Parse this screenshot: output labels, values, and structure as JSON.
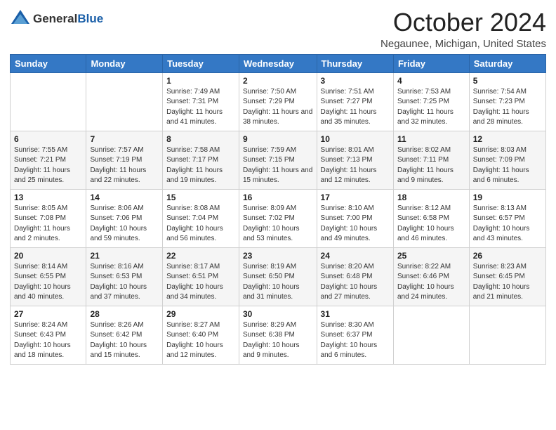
{
  "header": {
    "logo": {
      "general": "General",
      "blue": "Blue"
    },
    "month": "October 2024",
    "location": "Negaunee, Michigan, United States"
  },
  "weekdays": [
    "Sunday",
    "Monday",
    "Tuesday",
    "Wednesday",
    "Thursday",
    "Friday",
    "Saturday"
  ],
  "weeks": [
    [
      {
        "day": "",
        "info": ""
      },
      {
        "day": "",
        "info": ""
      },
      {
        "day": "1",
        "info": "Sunrise: 7:49 AM\nSunset: 7:31 PM\nDaylight: 11 hours and 41 minutes."
      },
      {
        "day": "2",
        "info": "Sunrise: 7:50 AM\nSunset: 7:29 PM\nDaylight: 11 hours and 38 minutes."
      },
      {
        "day": "3",
        "info": "Sunrise: 7:51 AM\nSunset: 7:27 PM\nDaylight: 11 hours and 35 minutes."
      },
      {
        "day": "4",
        "info": "Sunrise: 7:53 AM\nSunset: 7:25 PM\nDaylight: 11 hours and 32 minutes."
      },
      {
        "day": "5",
        "info": "Sunrise: 7:54 AM\nSunset: 7:23 PM\nDaylight: 11 hours and 28 minutes."
      }
    ],
    [
      {
        "day": "6",
        "info": "Sunrise: 7:55 AM\nSunset: 7:21 PM\nDaylight: 11 hours and 25 minutes."
      },
      {
        "day": "7",
        "info": "Sunrise: 7:57 AM\nSunset: 7:19 PM\nDaylight: 11 hours and 22 minutes."
      },
      {
        "day": "8",
        "info": "Sunrise: 7:58 AM\nSunset: 7:17 PM\nDaylight: 11 hours and 19 minutes."
      },
      {
        "day": "9",
        "info": "Sunrise: 7:59 AM\nSunset: 7:15 PM\nDaylight: 11 hours and 15 minutes."
      },
      {
        "day": "10",
        "info": "Sunrise: 8:01 AM\nSunset: 7:13 PM\nDaylight: 11 hours and 12 minutes."
      },
      {
        "day": "11",
        "info": "Sunrise: 8:02 AM\nSunset: 7:11 PM\nDaylight: 11 hours and 9 minutes."
      },
      {
        "day": "12",
        "info": "Sunrise: 8:03 AM\nSunset: 7:09 PM\nDaylight: 11 hours and 6 minutes."
      }
    ],
    [
      {
        "day": "13",
        "info": "Sunrise: 8:05 AM\nSunset: 7:08 PM\nDaylight: 11 hours and 2 minutes."
      },
      {
        "day": "14",
        "info": "Sunrise: 8:06 AM\nSunset: 7:06 PM\nDaylight: 10 hours and 59 minutes."
      },
      {
        "day": "15",
        "info": "Sunrise: 8:08 AM\nSunset: 7:04 PM\nDaylight: 10 hours and 56 minutes."
      },
      {
        "day": "16",
        "info": "Sunrise: 8:09 AM\nSunset: 7:02 PM\nDaylight: 10 hours and 53 minutes."
      },
      {
        "day": "17",
        "info": "Sunrise: 8:10 AM\nSunset: 7:00 PM\nDaylight: 10 hours and 49 minutes."
      },
      {
        "day": "18",
        "info": "Sunrise: 8:12 AM\nSunset: 6:58 PM\nDaylight: 10 hours and 46 minutes."
      },
      {
        "day": "19",
        "info": "Sunrise: 8:13 AM\nSunset: 6:57 PM\nDaylight: 10 hours and 43 minutes."
      }
    ],
    [
      {
        "day": "20",
        "info": "Sunrise: 8:14 AM\nSunset: 6:55 PM\nDaylight: 10 hours and 40 minutes."
      },
      {
        "day": "21",
        "info": "Sunrise: 8:16 AM\nSunset: 6:53 PM\nDaylight: 10 hours and 37 minutes."
      },
      {
        "day": "22",
        "info": "Sunrise: 8:17 AM\nSunset: 6:51 PM\nDaylight: 10 hours and 34 minutes."
      },
      {
        "day": "23",
        "info": "Sunrise: 8:19 AM\nSunset: 6:50 PM\nDaylight: 10 hours and 31 minutes."
      },
      {
        "day": "24",
        "info": "Sunrise: 8:20 AM\nSunset: 6:48 PM\nDaylight: 10 hours and 27 minutes."
      },
      {
        "day": "25",
        "info": "Sunrise: 8:22 AM\nSunset: 6:46 PM\nDaylight: 10 hours and 24 minutes."
      },
      {
        "day": "26",
        "info": "Sunrise: 8:23 AM\nSunset: 6:45 PM\nDaylight: 10 hours and 21 minutes."
      }
    ],
    [
      {
        "day": "27",
        "info": "Sunrise: 8:24 AM\nSunset: 6:43 PM\nDaylight: 10 hours and 18 minutes."
      },
      {
        "day": "28",
        "info": "Sunrise: 8:26 AM\nSunset: 6:42 PM\nDaylight: 10 hours and 15 minutes."
      },
      {
        "day": "29",
        "info": "Sunrise: 8:27 AM\nSunset: 6:40 PM\nDaylight: 10 hours and 12 minutes."
      },
      {
        "day": "30",
        "info": "Sunrise: 8:29 AM\nSunset: 6:38 PM\nDaylight: 10 hours and 9 minutes."
      },
      {
        "day": "31",
        "info": "Sunrise: 8:30 AM\nSunset: 6:37 PM\nDaylight: 10 hours and 6 minutes."
      },
      {
        "day": "",
        "info": ""
      },
      {
        "day": "",
        "info": ""
      }
    ]
  ]
}
